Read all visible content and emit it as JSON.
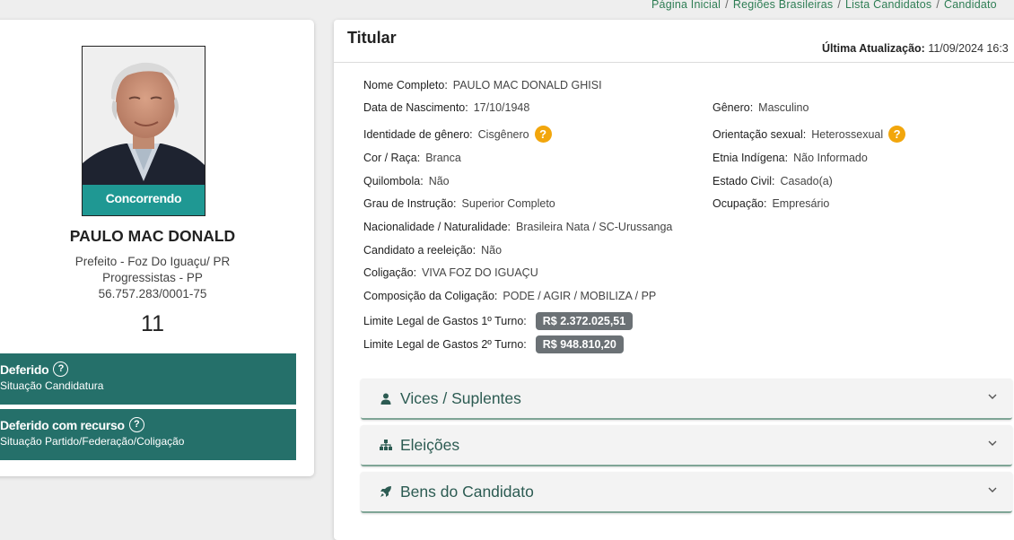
{
  "breadcrumb": [
    {
      "label": "Página Inicial"
    },
    {
      "label": "Regiões Brasileiras"
    },
    {
      "label": "Lista Candidatos"
    },
    {
      "label": "Candidato"
    }
  ],
  "candidate": {
    "status_ribbon": "Concorrendo",
    "name": "PAULO MAC DONALD",
    "office": "Prefeito - Foz Do Iguaçu/ PR",
    "party": "Progressistas - PP",
    "cnpj": "56.757.283/0001-75",
    "number": "11",
    "status_boxes": [
      {
        "title": "Deferido",
        "subtitle": "Situação Candidatura"
      },
      {
        "title": "Deferido com recurso",
        "subtitle": "Situação Partido/Federação/Coligação"
      }
    ]
  },
  "titular": {
    "title": "Titular",
    "last_update_label": "Última Atualização:",
    "last_update_value": "11/09/2024 16:3",
    "fields": {
      "nome_completo": {
        "label": "Nome Completo:",
        "value": "PAULO MAC DONALD GHISI"
      },
      "data_nascimento": {
        "label": "Data de Nascimento:",
        "value": "17/10/1948"
      },
      "genero": {
        "label": "Gênero:",
        "value": "Masculino"
      },
      "identidade_genero": {
        "label": "Identidade de gênero:",
        "value": "Cisgênero"
      },
      "orientacao_sexual": {
        "label": "Orientação sexual:",
        "value": "Heterossexual"
      },
      "cor_raca": {
        "label": "Cor / Raça:",
        "value": "Branca"
      },
      "etnia_indigena": {
        "label": "Etnia Indígena:",
        "value": "Não Informado"
      },
      "quilombola": {
        "label": "Quilombola:",
        "value": "Não"
      },
      "estado_civil": {
        "label": "Estado Civil:",
        "value": "Casado(a)"
      },
      "grau_instrucao": {
        "label": "Grau de Instrução:",
        "value": "Superior Completo"
      },
      "ocupacao": {
        "label": "Ocupação:",
        "value": "Empresário"
      },
      "nacionalidade": {
        "label": "Nacionalidade / Naturalidade:",
        "value": "Brasileira Nata / SC-Urussanga"
      },
      "reeleicao": {
        "label": "Candidato a reeleição:",
        "value": "Não"
      },
      "coligacao": {
        "label": "Coligação:",
        "value": "VIVA FOZ DO IGUAÇU"
      },
      "composicao": {
        "label": "Composição da Coligação:",
        "value": "PODE / AGIR / MOBILIZA / PP"
      },
      "limite_1": {
        "label": "Limite Legal de Gastos 1º Turno:",
        "value": "R$ 2.372.025,51"
      },
      "limite_2": {
        "label": "Limite Legal de Gastos 2º Turno:",
        "value": "R$ 948.810,20"
      }
    },
    "info_badge": "?"
  },
  "accordions": [
    {
      "label": "Vices / Suplentes",
      "icon": "person-icon"
    },
    {
      "label": "Eleições",
      "icon": "sitemap-icon"
    },
    {
      "label": "Bens do Candidato",
      "icon": "rocket-icon"
    }
  ],
  "colors": {
    "accent_green": "#25706a",
    "breadcrumb_green": "#2e7d54",
    "ribbon_teal": "#20b2aa",
    "badge_orange": "#f2a60c",
    "money_badge_gray": "#6b7175"
  }
}
